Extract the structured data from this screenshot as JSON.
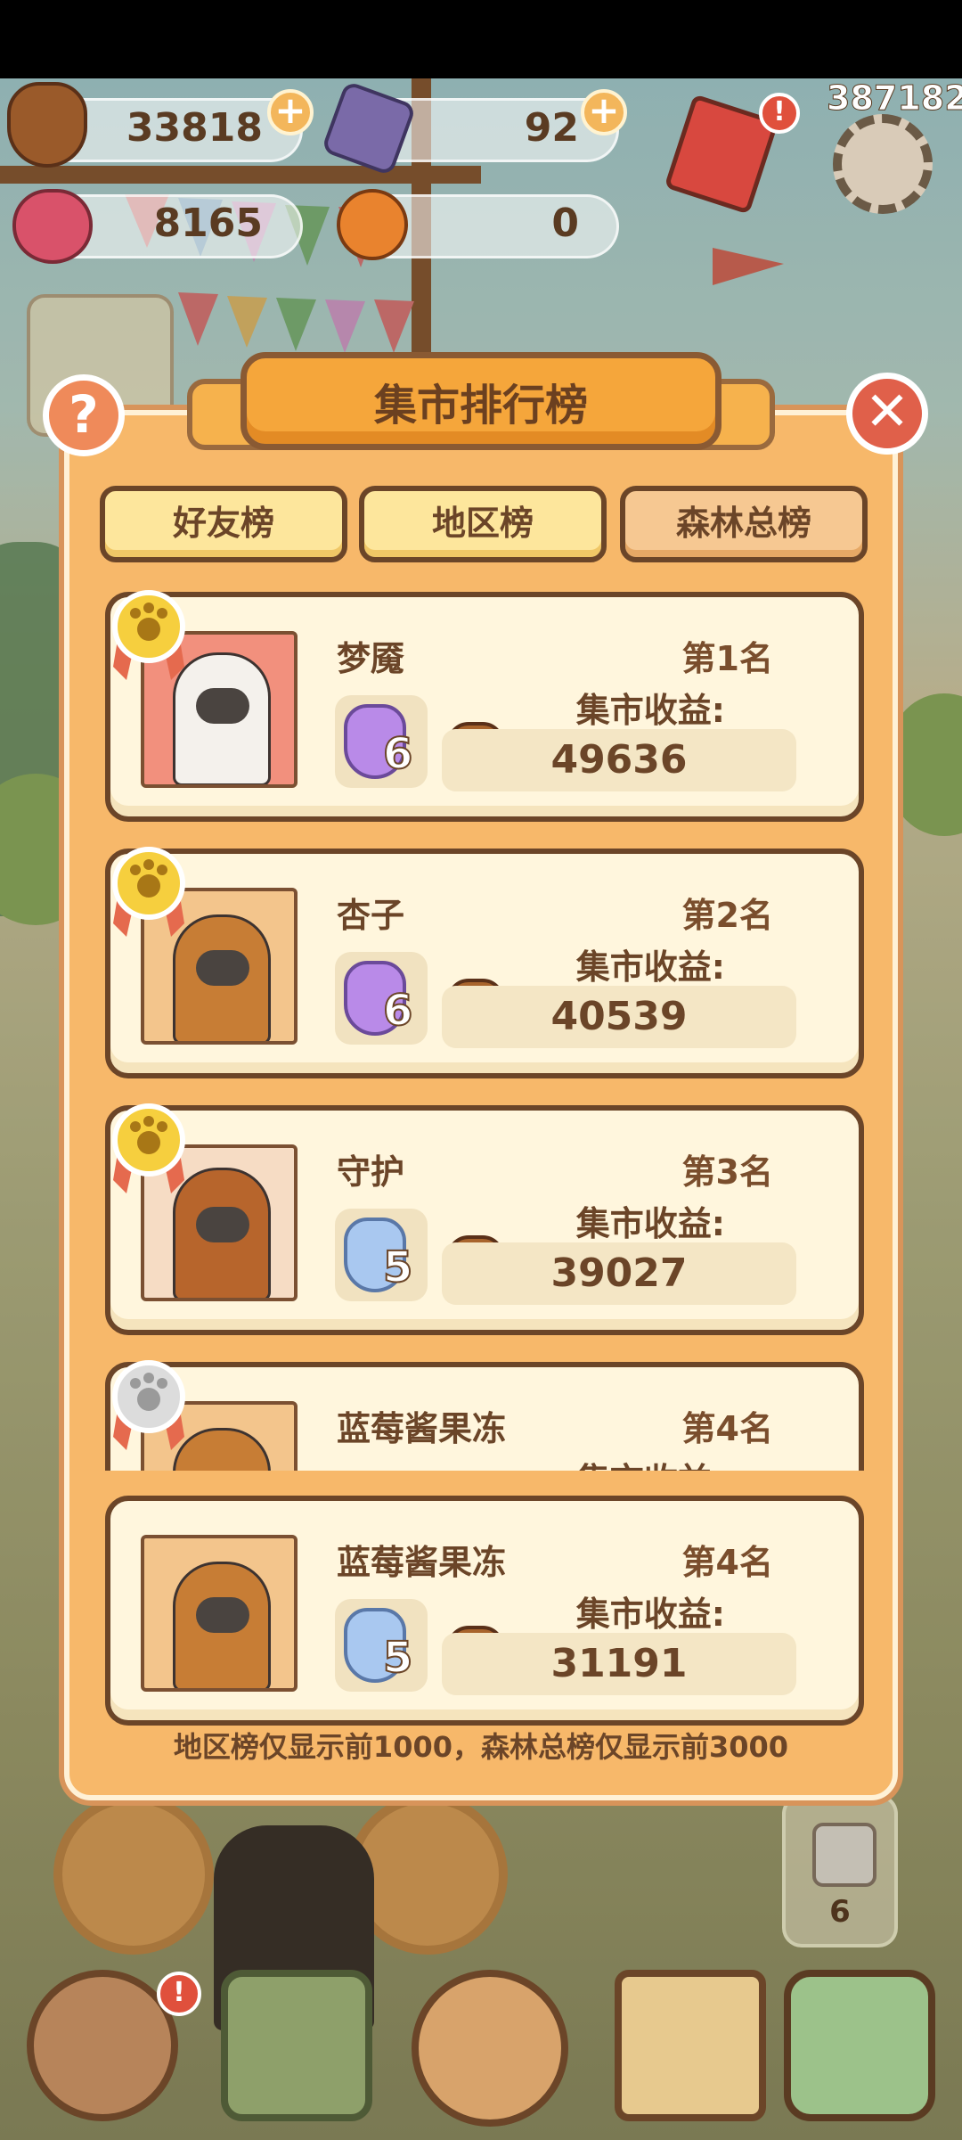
{
  "top_counter": "387182",
  "resources": [
    {
      "name": "acorn",
      "value": "33818"
    },
    {
      "name": "gem",
      "value": "92"
    },
    {
      "name": "heart-crystal",
      "value": "8165"
    },
    {
      "name": "orange",
      "value": "0"
    }
  ],
  "panel": {
    "title": "集市排行榜",
    "tabs": [
      {
        "label": "好友榜"
      },
      {
        "label": "地区榜"
      },
      {
        "label": "森林总榜"
      }
    ],
    "income_label": "集市收益:",
    "entries": [
      {
        "name": "梦魇",
        "rank": "第1名",
        "level": "6",
        "score": "49636",
        "medal": "gold"
      },
      {
        "name": "杏子",
        "rank": "第2名",
        "level": "6",
        "score": "40539",
        "medal": "gold"
      },
      {
        "name": "守护",
        "rank": "第3名",
        "level": "5",
        "score": "39027",
        "medal": "gold"
      },
      {
        "name": "蓝莓酱果冻",
        "rank": "第4名",
        "level": "5",
        "score": "",
        "medal": "silver"
      }
    ],
    "self_entry": {
      "name": "蓝莓酱果冻",
      "rank": "第4名",
      "level": "5",
      "score": "31191"
    },
    "footer_note": "地区榜仅显示前1000，森林总榜仅显示前3000"
  },
  "side_item": {
    "count": "6"
  },
  "colors": {
    "accent": "#f5a63b",
    "panel": "#f7b86a",
    "card": "#fff6dd",
    "text": "#6b4528"
  }
}
